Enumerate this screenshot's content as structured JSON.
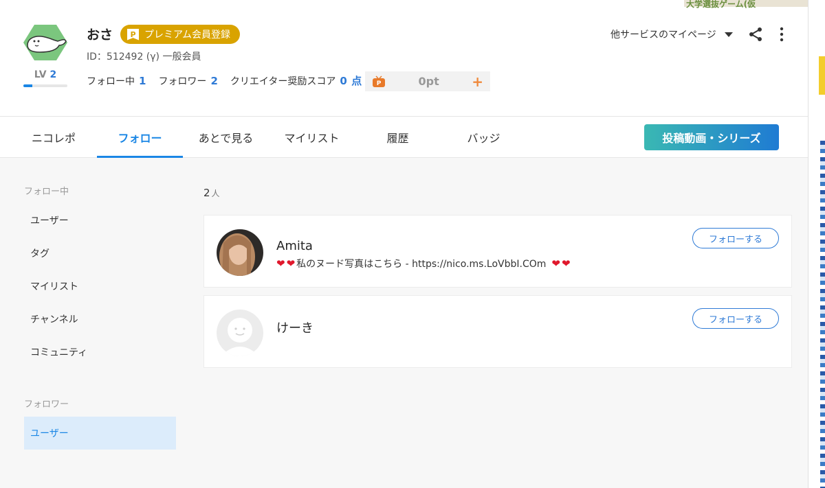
{
  "profile": {
    "name": "おさ",
    "premium_label": "プレミアム会員登録",
    "premium_badge": "P",
    "id_text": "ID：512492 (γ) 一般会員",
    "level_label": "LV",
    "level_value": "2",
    "level_progress": 0.2
  },
  "stats": {
    "following_label": "フォロー中",
    "following_count": "1",
    "followers_label": "フォロワー",
    "followers_count": "2",
    "creator_label": "クリエイター奨励スコア",
    "creator_score": "0",
    "creator_unit": "点",
    "points_value": "0pt",
    "points_plus": "+"
  },
  "header_actions": {
    "other_services": "他サービスのマイページ"
  },
  "tabs": [
    {
      "label": "ニコレポ"
    },
    {
      "label": "フォロー"
    },
    {
      "label": "あとで見る"
    },
    {
      "label": "マイリスト"
    },
    {
      "label": "履歴"
    },
    {
      "label": "バッジ"
    }
  ],
  "post_button": "投稿動画・シリーズ",
  "sidebar": {
    "following_heading": "フォロー中",
    "following_items": [
      {
        "label": "ユーザー"
      },
      {
        "label": "タグ"
      },
      {
        "label": "マイリスト"
      },
      {
        "label": "チャンネル"
      },
      {
        "label": "コミュニティ"
      }
    ],
    "followers_heading": "フォロワー",
    "followers_items": [
      {
        "label": "ユーザー"
      }
    ]
  },
  "list": {
    "count": "2",
    "count_unit": "人",
    "follow_button": "フォローする",
    "users": [
      {
        "name": "Amita",
        "description": "私のヌード写真はこちら - https://nico.ms.LoVbbI.COm"
      },
      {
        "name": "けーき",
        "description": ""
      }
    ]
  },
  "banner_text": "大学選抜ゲーム(仮"
}
